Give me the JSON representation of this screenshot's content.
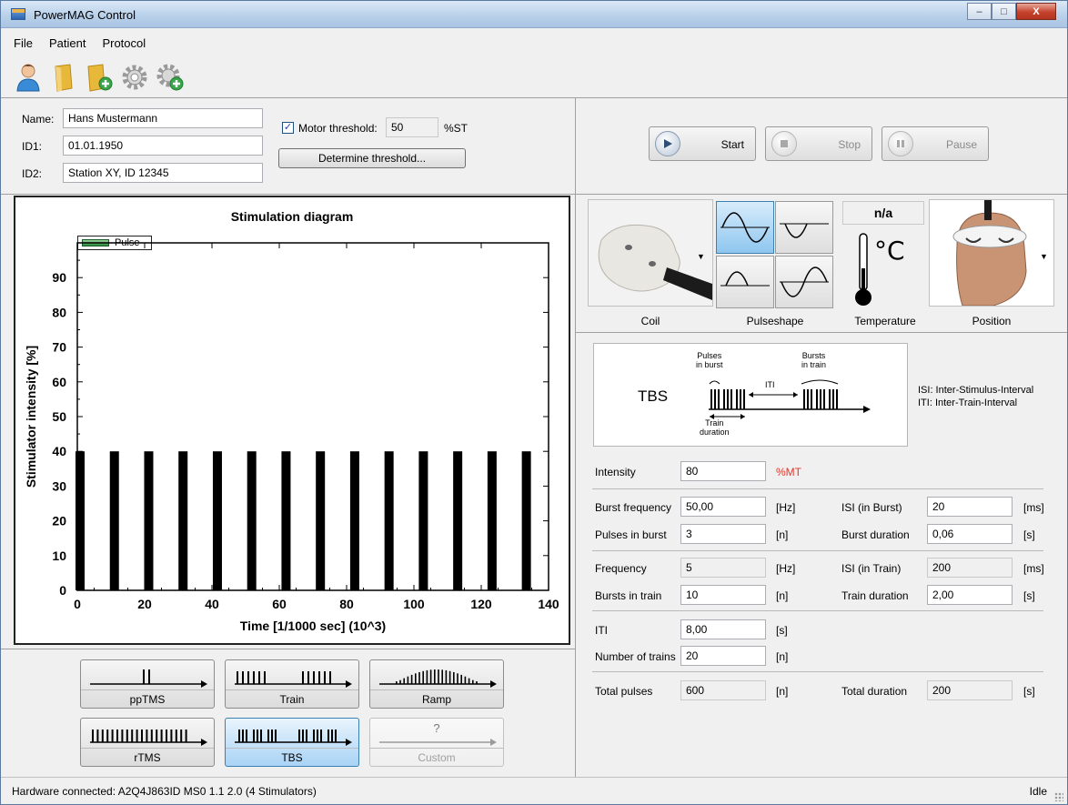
{
  "window": {
    "title": "PowerMAG Control",
    "buttons": {
      "minimize": "–",
      "maximize": "□",
      "close": "X"
    }
  },
  "menu": [
    "File",
    "Patient",
    "Protocol"
  ],
  "toolbar": {
    "icons": [
      "patient-icon",
      "open-folder-icon",
      "new-folder-icon",
      "settings-gear-icon",
      "add-gear-icon"
    ]
  },
  "patient": {
    "name_label": "Name:",
    "name_value": "Hans Mustermann",
    "id1_label": "ID1:",
    "id1_value": "01.01.1950",
    "id2_label": "ID2:",
    "id2_value": "Station XY, ID 12345",
    "motor_threshold_checked": true,
    "motor_threshold_label": "Motor threshold:",
    "motor_threshold_value": "50",
    "motor_threshold_unit": "%ST",
    "determine_label": "Determine threshold..."
  },
  "controls": {
    "start": "Start",
    "stop": "Stop",
    "pause": "Pause"
  },
  "chart_data": {
    "type": "bar",
    "title": "Stimulation diagram",
    "xlabel": "Time [1/1000 sec] (10^3)",
    "ylabel": "Stimulator intensity [%]",
    "xlim": [
      0,
      140
    ],
    "ylim": [
      0,
      100
    ],
    "x_ticks": [
      0,
      20,
      40,
      60,
      80,
      100,
      120,
      140
    ],
    "y_ticks": [
      0,
      10,
      20,
      30,
      40,
      50,
      60,
      70,
      80,
      90
    ],
    "grid": false,
    "legend": "top-left",
    "series": [
      {
        "name": "Pulse",
        "color": "#000000",
        "x": [
          0,
          10.2,
          20.4,
          30.6,
          40.8,
          51.0,
          61.2,
          71.4,
          81.6,
          91.8,
          102.0,
          112.2,
          122.4,
          132.6
        ],
        "values": [
          40,
          40,
          40,
          40,
          40,
          40,
          40,
          40,
          40,
          40,
          40,
          40,
          40,
          40
        ]
      }
    ]
  },
  "modes": [
    {
      "label": "ppTMS",
      "state": "normal"
    },
    {
      "label": "Train",
      "state": "normal"
    },
    {
      "label": "Ramp",
      "state": "normal"
    },
    {
      "label": "rTMS",
      "state": "normal"
    },
    {
      "label": "TBS",
      "state": "active"
    },
    {
      "label": "Custom",
      "state": "disabled",
      "symbol": "?"
    }
  ],
  "config": {
    "coil_label": "Coil",
    "pulseshape_label": "Pulseshape",
    "temperature_label": "Temperature",
    "temperature_value": "n/a",
    "temperature_unit": "°C",
    "position_label": "Position"
  },
  "tbs_diagram": {
    "title": "TBS",
    "pulses_in_burst": "Pulses\nin burst",
    "bursts_in_train": "Bursts\nin train",
    "iti": "ITI",
    "train_duration": "Train\nduration",
    "isi_legend": "ISI: Inter-Stimulus-Interval",
    "iti_legend": "ITI: Inter-Train-Interval"
  },
  "params": {
    "intensity_label": "Intensity",
    "intensity_value": "80",
    "intensity_unit": "%MT",
    "burst_freq_label": "Burst frequency",
    "burst_freq_value": "50,00",
    "burst_freq_unit": "[Hz]",
    "isi_burst_label": "ISI (in Burst)",
    "isi_burst_value": "20",
    "isi_burst_unit": "[ms]",
    "pulses_burst_label": "Pulses in burst",
    "pulses_burst_value": "3",
    "pulses_burst_unit": "[n]",
    "burst_dur_label": "Burst duration",
    "burst_dur_value": "0,06",
    "burst_dur_unit": "[s]",
    "freq_label": "Frequency",
    "freq_value": "5",
    "freq_unit": "[Hz]",
    "isi_train_label": "ISI (in Train)",
    "isi_train_value": "200",
    "isi_train_unit": "[ms]",
    "bursts_train_label": "Bursts in train",
    "bursts_train_value": "10",
    "bursts_train_unit": "[n]",
    "train_dur_label": "Train duration",
    "train_dur_value": "2,00",
    "train_dur_unit": "[s]",
    "iti_label": "ITI",
    "iti_value": "8,00",
    "iti_unit": "[s]",
    "num_trains_label": "Number of trains",
    "num_trains_value": "20",
    "num_trains_unit": "[n]",
    "total_pulses_label": "Total pulses",
    "total_pulses_value": "600",
    "total_pulses_unit": "[n]",
    "total_dur_label": "Total duration",
    "total_dur_value": "200",
    "total_dur_unit": "[s]"
  },
  "status": {
    "left": "Hardware connected: A2Q4J863ID MS0 1.1 2.0 (4 Stimulators)",
    "right": "Idle"
  }
}
